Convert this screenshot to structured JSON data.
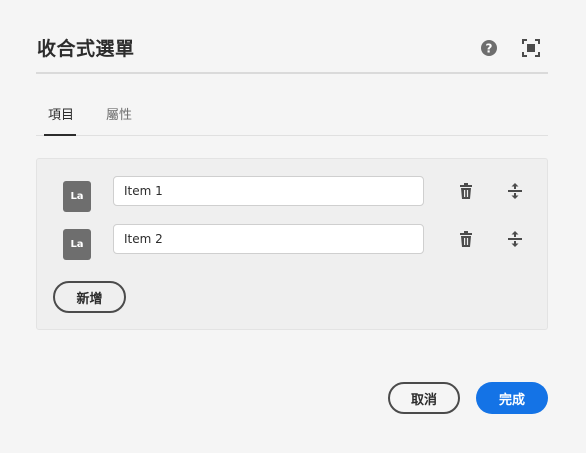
{
  "dialog": {
    "title": "收合式選單",
    "icons": {
      "help": "help-icon",
      "fullscreen": "fullscreen-icon"
    }
  },
  "tabs": [
    {
      "label": "項目",
      "selected": true
    },
    {
      "label": "屬性",
      "selected": false
    }
  ],
  "items": [
    {
      "badge": "La",
      "value": "Item 1",
      "icons": [
        "trash-icon",
        "move-icon"
      ]
    },
    {
      "badge": "La",
      "value": "Item 2",
      "icons": [
        "trash-icon",
        "move-icon"
      ]
    }
  ],
  "add_button": "新增",
  "footer": {
    "cancel": "取消",
    "done": "完成"
  },
  "colors": {
    "background": "#f5f5f5",
    "panel": "#efefef",
    "accent": "#1473e6",
    "badge": "#6e6e6e",
    "text": "#2c2c2c"
  }
}
